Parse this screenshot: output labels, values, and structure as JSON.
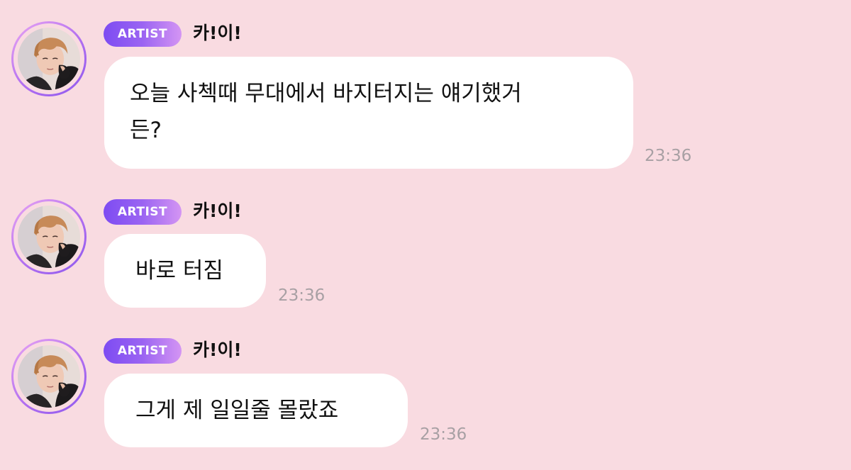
{
  "messages": [
    {
      "badge": "ARTIST",
      "sender": "카!이!",
      "text": "오늘 사첵때 무대에서 바지터지는 얘기했거\n든?",
      "time": "23:36",
      "avatar": "artist-profile-photo"
    },
    {
      "badge": "ARTIST",
      "sender": "카!이!",
      "text": "바로 터짐",
      "time": "23:36",
      "avatar": "artist-profile-photo"
    },
    {
      "badge": "ARTIST",
      "sender": "카!이!",
      "text": "그게 제 일일줄 몰랐죠",
      "time": "23:36",
      "avatar": "artist-profile-photo"
    }
  ],
  "colors": {
    "background": "#f9dbe1",
    "bubble": "#ffffff",
    "badge_start": "#7d4cf2",
    "badge_end": "#d495f3",
    "avatar_ring": "#b16ef0",
    "timestamp": "#a8a0a4"
  }
}
